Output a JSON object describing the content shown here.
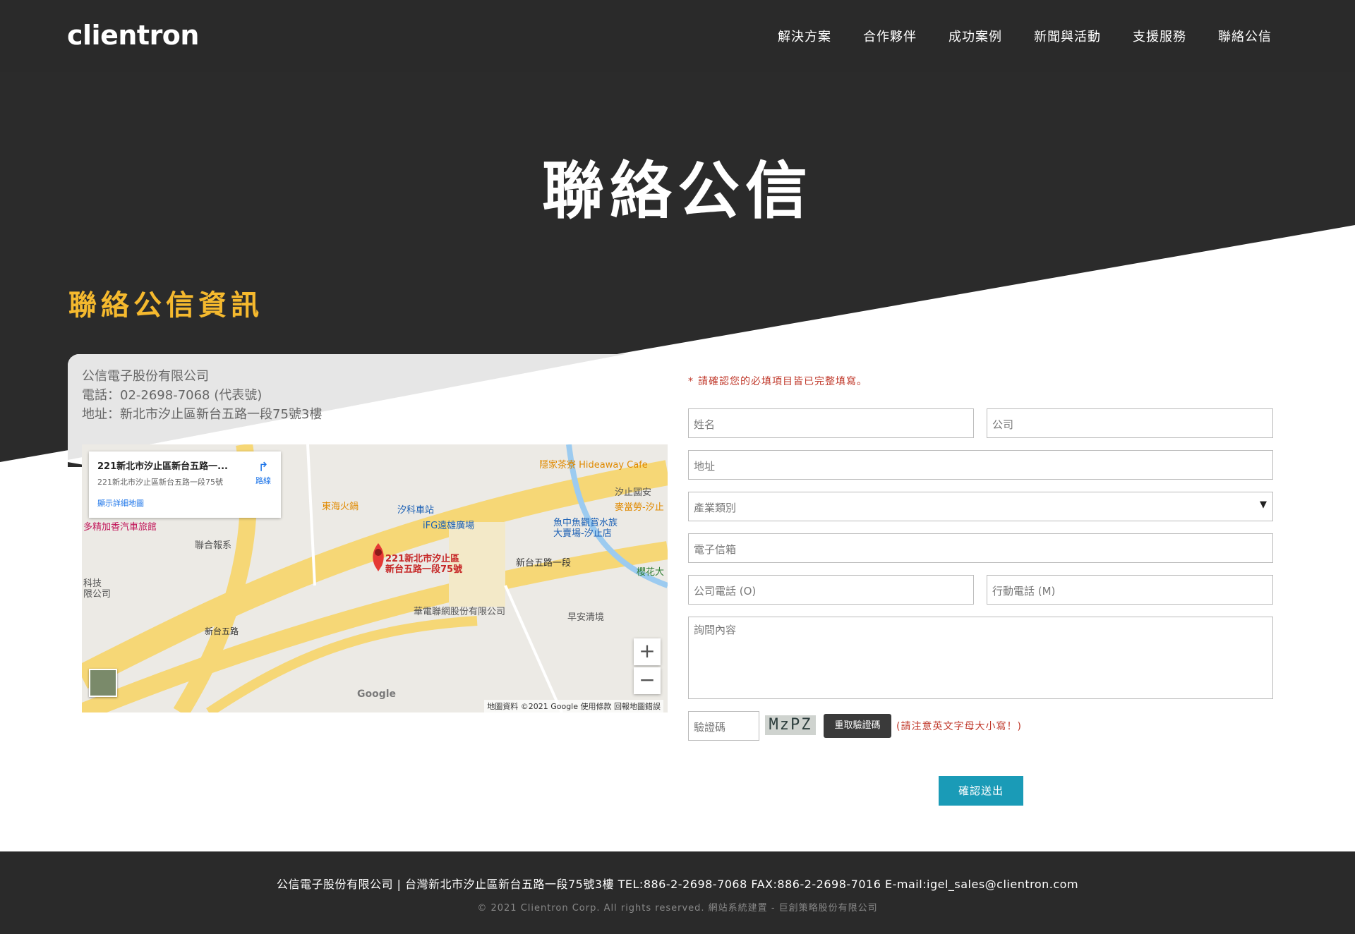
{
  "header": {
    "logo": "clientron",
    "nav": [
      "解決方案",
      "合作夥伴",
      "成功案例",
      "新聞與活動",
      "支援服務",
      "聯絡公信"
    ]
  },
  "hero": {
    "title": "聯絡公信",
    "section_title": "聯絡公信資訊"
  },
  "info": {
    "company": "公信電子股份有限公司",
    "phone": "電話：02-2698-7068 (代表號)",
    "address": "地址：新北市汐止區新台五路一段75號3樓"
  },
  "map": {
    "card_title": "221新北市汐止區新台五路一...",
    "card_address": "221新北市汐止區新台五路一段75號",
    "card_link": "顯示詳細地圖",
    "directions": "路線",
    "pin_label_1": "221新北市汐止區",
    "pin_label_2": "新台五路一段75號",
    "labels": {
      "cafe": "隱家茶寮 Hideaway Cafe",
      "hotpot": "東海火鍋",
      "station": "汐科車站",
      "plaza": "iFG遠雄廣場",
      "mcd": "麥當勞-汐止",
      "motel": "多精加香汽車旅館",
      "udn": "聯合報系",
      "fish_1": "魚中魚觀賞水族",
      "fish_2": "大賣場-汐止店",
      "road": "新台五路一段",
      "cht": "華電聯網股份有限公司",
      "clean": "早安清境",
      "tech_1": "科技",
      "tech_2": "限公司",
      "xintai": "新台五路",
      "sakura": "櫻花大",
      "xizhi": "汐止國安"
    },
    "google": "Google",
    "footer": "地圖資料 ©2021 Google   使用條款   回報地圖錯誤",
    "zoom_in": "+",
    "zoom_out": "−"
  },
  "form": {
    "notice": "請確認您的必填項目皆已完整填寫。",
    "notice_star": "*",
    "name_ph": "姓名",
    "company_ph": "公司",
    "address_ph": "地址",
    "industry_ph": "產業類別",
    "email_ph": "電子信箱",
    "tel_ph": "公司電話 (O)",
    "mobile_ph": "行動電話 (M)",
    "inquiry_ph": "詢問內容",
    "captcha_ph": "驗證碼",
    "captcha_code": "MzPZ",
    "captcha_refresh": "重取驗證碼",
    "captcha_note": "(請注意英文字母大小寫！)",
    "submit": "確認送出"
  },
  "footer": {
    "line1": "公信電子股份有限公司 | 台灣新北市汐止區新台五路一段75號3樓    TEL:886-2-2698-7068    FAX:886-2-2698-7016    E-mail:igel_sales@clientron.com",
    "line2": "© 2021 Clientron Corp. All rights reserved. 網站系統建置 - 巨創策略股份有限公司"
  }
}
